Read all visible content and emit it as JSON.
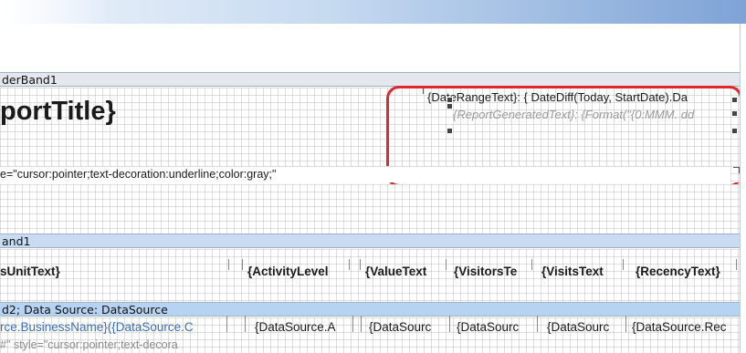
{
  "report_header_band": {
    "label": "derBand1"
  },
  "report_title": {
    "text": "portTitle}"
  },
  "date_range": {
    "line1": "{DateRangeText}: { DateDiff(Today, StartDate).Da",
    "line2": "{ReportGeneratedText}: {Format(\"{0:MMM. dd"
  },
  "style_line": {
    "text": "e=\"cursor:pointer;text-decoration:underline;color:gray;\""
  },
  "page_header_band": {
    "label": "and1"
  },
  "columns": [
    {
      "label": "sUnitText}"
    },
    {
      "label": "{ActivityLevel"
    },
    {
      "label": "{ValueText"
    },
    {
      "label": "{VisitorsTe"
    },
    {
      "label": "{VisitsText"
    },
    {
      "label": "{RecencyText}"
    }
  ],
  "data_band": {
    "label": "d2; Data Source: DataSource"
  },
  "data_row": {
    "first_cell": "rce.BusinessName}({DataSource.C",
    "cells": [
      {
        "value": "{DataSource.A"
      },
      {
        "value": "{DataSourc"
      },
      {
        "value": "{DataSourc"
      },
      {
        "value": "{DataSourc"
      },
      {
        "value": "{DataSource.Rec"
      }
    ]
  },
  "cut_row": {
    "text": "#\" style=\"cursor:pointer;text-decora"
  },
  "colors": {
    "highlight": "#e3262c",
    "band_blue": "#c9dcf2",
    "link_blue": "#3a6fb5"
  }
}
